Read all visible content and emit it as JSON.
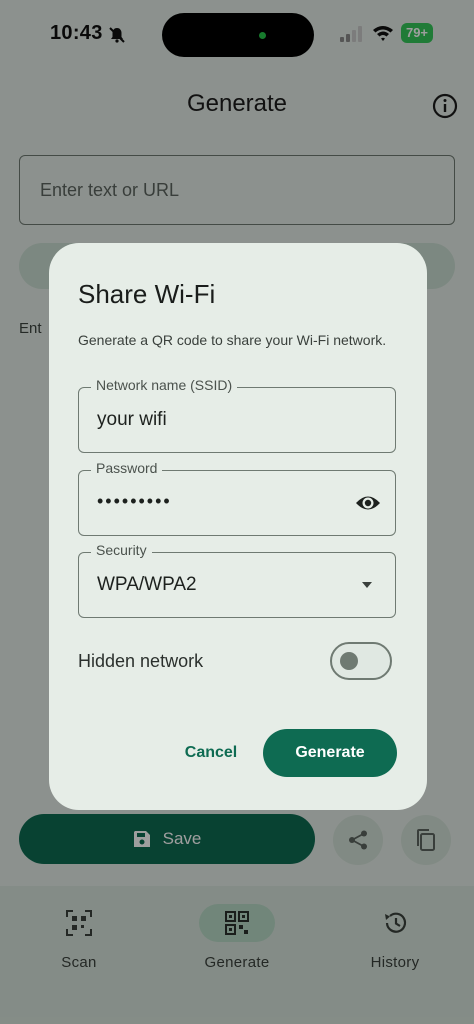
{
  "status_bar": {
    "time": "10:43",
    "battery": "79+",
    "icons": [
      "bell-slash-icon",
      "signal-icon",
      "wifi-icon"
    ]
  },
  "header": {
    "title": "Generate",
    "info_icon": "info-icon"
  },
  "background": {
    "input_placeholder": "Enter text or URL",
    "partial_text": "Ent",
    "save_label": "Save"
  },
  "dialog": {
    "title": "Share Wi-Fi",
    "description": "Generate a QR code to share your Wi-Fi network.",
    "ssid": {
      "label": "Network name (SSID)",
      "value": "your wifi"
    },
    "password": {
      "label": "Password",
      "value": "•••••••••"
    },
    "security": {
      "label": "Security",
      "value": "WPA/WPA2"
    },
    "hidden": {
      "label": "Hidden network",
      "on": false
    },
    "cancel_label": "Cancel",
    "generate_label": "Generate"
  },
  "bottom_nav": {
    "items": [
      {
        "label": "Scan",
        "icon": "qr-scan-icon"
      },
      {
        "label": "Generate",
        "icon": "qr-code-icon",
        "active": true
      },
      {
        "label": "History",
        "icon": "history-icon"
      }
    ]
  },
  "colors": {
    "primary": "#0e6b52",
    "surface": "#e6ede7",
    "background": "#e3ebe5"
  }
}
